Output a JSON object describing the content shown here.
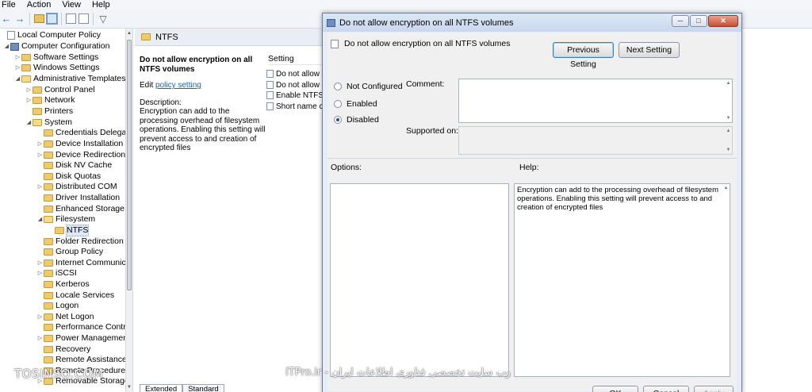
{
  "menu": [
    "File",
    "Action",
    "View",
    "Help"
  ],
  "toolbar": {
    "icons": [
      "back-arrow-icon",
      "forward-arrow-icon",
      "up-folder-icon",
      "show-tree-icon",
      "export-icon",
      "properties-icon",
      "filter-icon"
    ]
  },
  "tree": {
    "items": [
      {
        "label": "Local Computer Policy"
      },
      {
        "label": "Computer Configuration"
      },
      {
        "label": "Software Settings"
      },
      {
        "label": "Windows Settings"
      },
      {
        "label": "Administrative Templates"
      },
      {
        "label": "Control Panel"
      },
      {
        "label": "Network"
      },
      {
        "label": "Printers"
      },
      {
        "label": "System"
      },
      {
        "label": "Credentials Delegatio"
      },
      {
        "label": "Device Installation"
      },
      {
        "label": "Device Redirection"
      },
      {
        "label": "Disk NV Cache"
      },
      {
        "label": "Disk Quotas"
      },
      {
        "label": "Distributed COM"
      },
      {
        "label": "Driver Installation"
      },
      {
        "label": "Enhanced Storage Ac"
      },
      {
        "label": "Filesystem"
      },
      {
        "label": "NTFS"
      },
      {
        "label": "Folder Redirection"
      },
      {
        "label": "Group Policy"
      },
      {
        "label": "Internet Communica"
      },
      {
        "label": "iSCSI"
      },
      {
        "label": "Kerberos"
      },
      {
        "label": "Locale Services"
      },
      {
        "label": "Logon"
      },
      {
        "label": "Net Logon"
      },
      {
        "label": "Performance Control"
      },
      {
        "label": "Power Management"
      },
      {
        "label": "Recovery"
      },
      {
        "label": "Remote Assistance"
      },
      {
        "label": "Remote Procedure Ca"
      },
      {
        "label": "Removable Storage A"
      }
    ]
  },
  "detail": {
    "header": "NTFS",
    "policy_title": "Do not allow encryption on all NTFS volumes",
    "edit_prefix": "Edit",
    "edit_link": "policy setting",
    "description_label": "Description:",
    "description": "Encryption can add to the processing overhead of filesystem operations. Enabling this setting will prevent access to and creation of encrypted files",
    "settings_header": "Setting",
    "settings": [
      "Do not allow c",
      "Do not allow e",
      "Enable NTFS p",
      "Short name cr"
    ],
    "tabs": [
      "Extended",
      "Standard"
    ]
  },
  "dialog": {
    "title": "Do not allow encryption on all NTFS volumes",
    "subtitle": "Do not allow encryption on all NTFS volumes",
    "prev_button": "Previous Setting",
    "next_button": "Next Setting",
    "radios": [
      "Not Configured",
      "Enabled",
      "Disabled"
    ],
    "selected": "Disabled",
    "comment_label": "Comment:",
    "supported_label": "Supported on:",
    "options_label": "Options:",
    "help_label": "Help:",
    "help_text": "Encryption can add to the processing overhead of filesystem operations.  Enabling this setting will prevent access to and creation of encrypted files",
    "ok": "OK",
    "cancel": "Cancel",
    "apply": "Apply"
  },
  "watermark": {
    "left": "TOSINSO.COM",
    "mid": "ITPro.ir - وب سایت تخصصی فناوری اطلاعات ایران"
  }
}
